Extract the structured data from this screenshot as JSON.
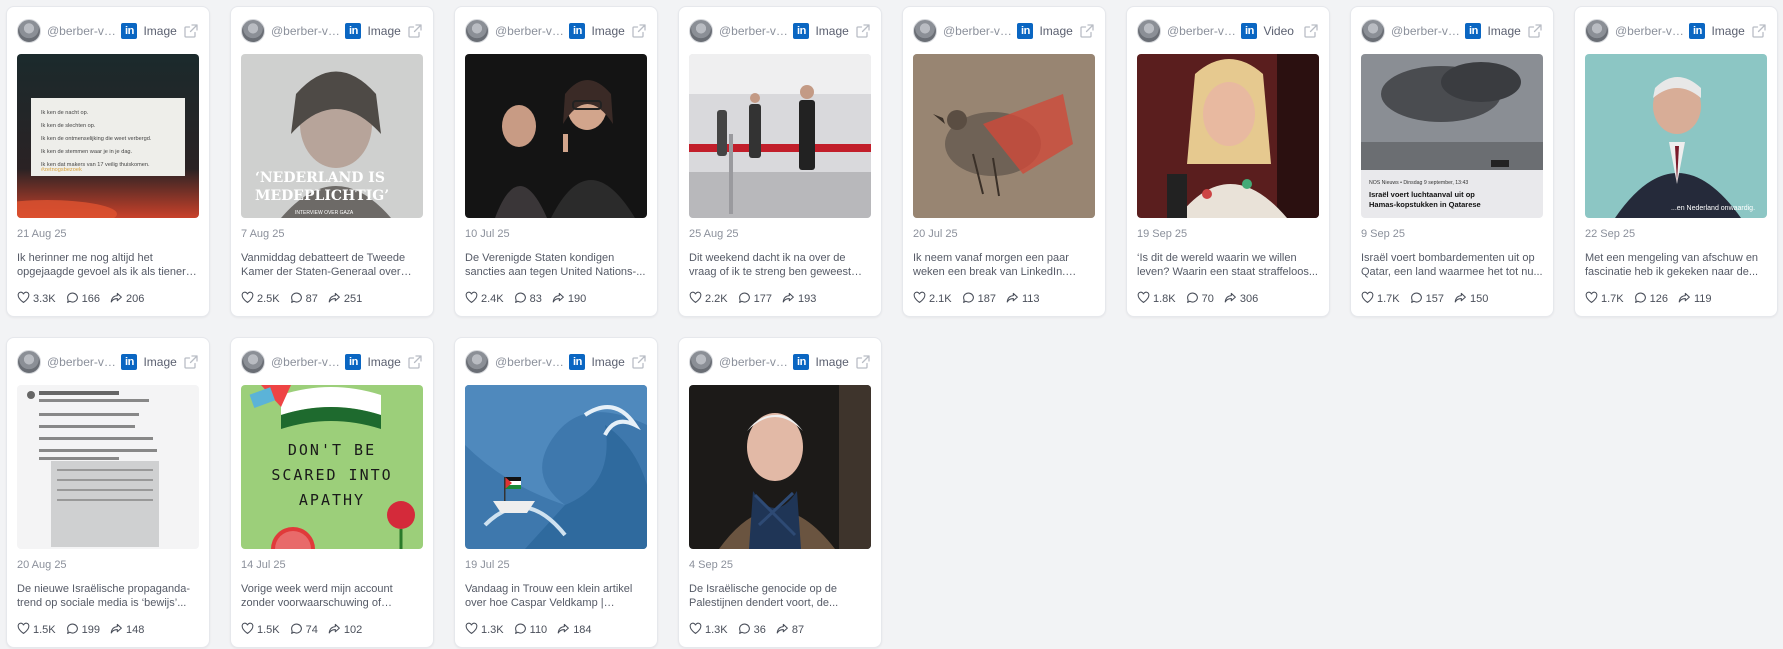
{
  "cards": [
    {
      "handle": "@berber-va...",
      "type": "Image",
      "date": "21 Aug 25",
      "caption": "Ik herinner me nog altijd het opgejaagde gevoel als ik als tiener in...",
      "likes": "3.3K",
      "comments": "166",
      "shares": "206",
      "thumb": "text-card",
      "thumb_lines": [
        "Ik ken de nacht op.",
        "Ik ken de slechten op.",
        "Ik ken de ontmenselijking die weet verbergd.",
        "Ik ken de stemmen waar je in je dag.",
        "Ik ken dat makers van 17 veilig thuiskomen."
      ],
      "thumb_tag": "#zetnogsbezoek"
    },
    {
      "handle": "@berber-va...",
      "type": "Image",
      "date": "7 Aug 25",
      "caption": "Vanmiddag debatteert de Tweede Kamer der Staten-Generaal over de...",
      "likes": "2.5K",
      "comments": "87",
      "shares": "251",
      "thumb": "poster",
      "thumb_title1": "‘NEDERLAND IS",
      "thumb_title2": "MEDEPLICHTIG’",
      "thumb_sub": "INTERVIEW OVER GAZA"
    },
    {
      "handle": "@berber-va...",
      "type": "Image",
      "date": "10 Jul 25",
      "caption": "De Verenigde Staten kondigen sancties aan tegen United Nations-...",
      "likes": "2.4K",
      "comments": "83",
      "shares": "190",
      "thumb": "duo-photo"
    },
    {
      "handle": "@berber-va...",
      "type": "Image",
      "date": "25 Aug 25",
      "caption": "Dit weekend dacht ik na over de vraag of ik te streng ben geweest voor...",
      "likes": "2.2K",
      "comments": "177",
      "shares": "193",
      "thumb": "hallway"
    },
    {
      "handle": "@berber-va...",
      "type": "Image",
      "date": "20 Jul 25",
      "caption": "Ik neem vanaf morgen een paar weken een break van LinkedIn. Ook...",
      "likes": "2.1K",
      "comments": "187",
      "shares": "113",
      "thumb": "bird-art"
    },
    {
      "handle": "@berber-va...",
      "type": "Video",
      "date": "19 Sep 25",
      "caption": "‘Is dit de wereld waarin we willen leven? Waarin een staat straffeloos...",
      "likes": "1.8K",
      "comments": "70",
      "shares": "306",
      "thumb": "speaker"
    },
    {
      "handle": "@berber-va...",
      "type": "Image",
      "date": "9 Sep 25",
      "caption": "Israël voert bombardementen uit op Qatar, een land waarmee het tot nu...",
      "likes": "1.7K",
      "comments": "157",
      "shares": "150",
      "thumb": "news",
      "thumb_meta": "NOS Nieuws • Dinsdag 9 september, 13:43",
      "thumb_head1": "Israël voert luchtaanval uit op",
      "thumb_head2": "Hamas-kopstukken in Qatarese"
    },
    {
      "handle": "@berber-va...",
      "type": "Image",
      "date": "22 Sep 25",
      "caption": "Met een mengeling van afschuw en fascinatie heb ik gekeken naar de...",
      "likes": "1.7K",
      "comments": "126",
      "shares": "119",
      "thumb": "suit",
      "thumb_subtitle": "...en Nederland onwaardig."
    },
    {
      "handle": "@berber-va...",
      "type": "Image",
      "date": "20 Aug 25",
      "caption": "De nieuwe Israëlische propaganda-trend op sociale media is ‘bewijs’...",
      "likes": "1.5K",
      "comments": "199",
      "shares": "148",
      "thumb": "tweet"
    },
    {
      "handle": "@berber-va...",
      "type": "Image",
      "date": "14 Jul 25",
      "caption": "Vorige week werd mijn account zonder voorwaarschuwing of verklaring van...",
      "likes": "1.5K",
      "comments": "74",
      "shares": "102",
      "thumb": "green-art",
      "thumb_words": [
        "DON'T BE",
        "SCARED INTO",
        "APATHY"
      ]
    },
    {
      "handle": "@berber-va...",
      "type": "Image",
      "date": "19 Jul 25",
      "caption": "Vandaag in Trouw een klein artikel over hoe Caspar Veldkamp | Minister...",
      "likes": "1.3K",
      "comments": "110",
      "shares": "184",
      "thumb": "wave-art"
    },
    {
      "handle": "@berber-va...",
      "type": "Image",
      "date": "4 Sep 25",
      "caption": "De Israëlische genocide op de Palestijnen dendert voort, de...",
      "likes": "1.3K",
      "comments": "36",
      "shares": "87",
      "thumb": "portrait"
    }
  ],
  "icons": {
    "linkedin": "in",
    "external": "external-link-icon",
    "like": "heart-icon",
    "comment": "comment-icon",
    "share": "share-icon"
  },
  "colors": {
    "linkedin": "#0a66c2",
    "background": "#f2f3f5",
    "card": "#ffffff"
  }
}
